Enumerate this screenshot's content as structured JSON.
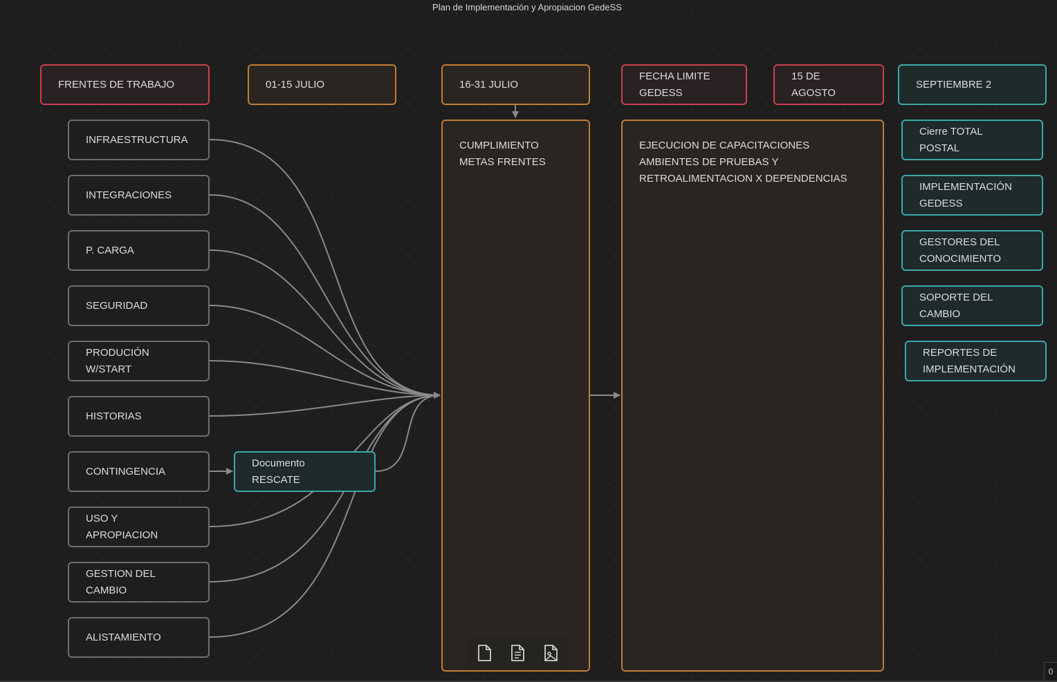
{
  "title": "Plan de Implementación y Apropiacion GedeSS",
  "colors": {
    "background": "#1e1e1e",
    "gray_border": "#6e6e6e",
    "red_border": "#c9414f",
    "orange_border": "#c07d35",
    "teal_border": "#3aa9a7",
    "edge": "#8a8a8a"
  },
  "headers": {
    "frentes": "FRENTES DE TRABAJO",
    "julio_1": "01-15 JULIO",
    "julio_2": "16-31 JULIO",
    "fecha_limite": "FECHA LIMITE\nGEDESS",
    "agosto": "15 DE\nAGOSTO",
    "septiembre": "SEPTIEMBRE 2"
  },
  "fronts": [
    "INFRAESTRUCTURA",
    "INTEGRACIONES",
    "P. CARGA",
    "SEGURIDAD",
    "PRODUCIÓN\nW/START",
    "HISTORIAS",
    "CONTINGENCIA",
    "USO Y\nAPROPIACION",
    "GESTION DEL\nCAMBIO",
    "ALISTAMIENTO"
  ],
  "documento": "Documento\nRESCATE",
  "cumplimiento": "CUMPLIMIENTO\nMETAS FRENTES",
  "ejecucion": "EJECUCION DE CAPACITACIONES\nAMBIENTES DE PRUEBAS Y\nRETROALIMENTACION X DEPENDENCIAS",
  "september_items": [
    "Cierre TOTAL\nPOSTAL",
    "IMPLEMENTACIÓN\nGEDESS",
    "GESTORES DEL\nCONOCIMIENTO",
    "SOPORTE DEL\nCAMBIO",
    "REPORTES DE\nIMPLEMENTACIÓN"
  ],
  "toolbar": {
    "tools": [
      "new-note-icon",
      "text-file-icon",
      "media-file-icon"
    ]
  },
  "corner_count": "0"
}
